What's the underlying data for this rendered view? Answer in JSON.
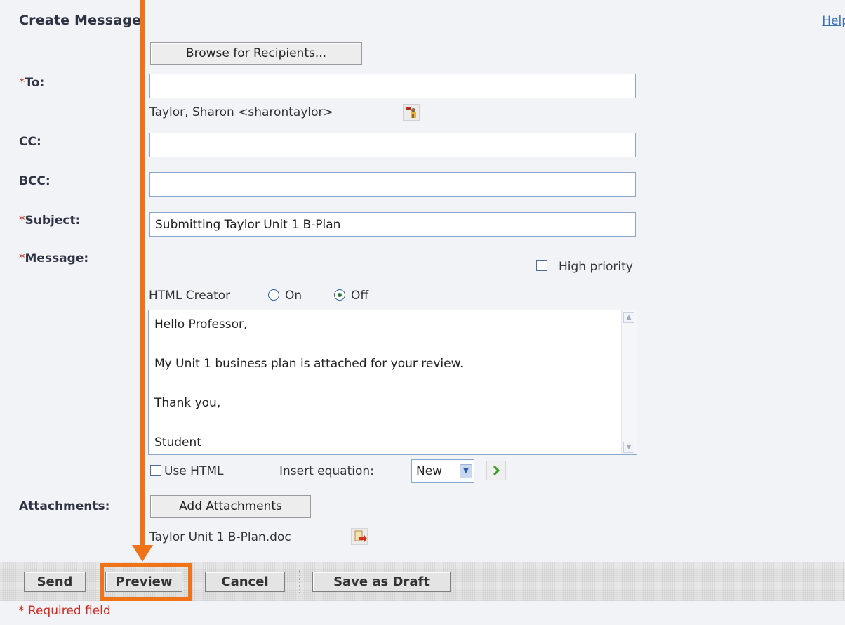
{
  "header": {
    "title": "Create Message",
    "help": "Help"
  },
  "recipients": {
    "browse_label": "Browse for Recipients..."
  },
  "fields": {
    "to": {
      "label": "To:",
      "value": "",
      "selected_recipient": "Taylor, Sharon <sharontaylor>"
    },
    "cc": {
      "label": "CC:",
      "value": ""
    },
    "bcc": {
      "label": "BCC:",
      "value": ""
    },
    "subject": {
      "label": "Subject:",
      "value": "Submitting Taylor Unit 1 B-Plan"
    },
    "message": {
      "label": "Message:"
    },
    "required_marker": "*"
  },
  "options": {
    "high_priority": "High priority",
    "html_creator": {
      "label": "HTML Creator",
      "on": "On",
      "off": "Off",
      "selected": "Off"
    }
  },
  "message_body": {
    "lines": [
      "Hello Professor,",
      "My Unit 1 business plan is attached for your review.",
      "Thank you,",
      "Student"
    ]
  },
  "editor_tools": {
    "use_html": "Use HTML",
    "insert_equation": "Insert equation:",
    "equation_option": "New"
  },
  "attachments": {
    "label": "Attachments:",
    "add_label": "Add Attachments",
    "file": "Taylor Unit 1 B-Plan.doc"
  },
  "actions": {
    "send": "Send",
    "preview": "Preview",
    "cancel": "Cancel",
    "save_draft": "Save as Draft"
  },
  "footer": {
    "required_note": "* Required field"
  },
  "colors": {
    "highlight": "#f07318",
    "required": "#d0281c",
    "link": "#3a6fb7"
  },
  "icons": [
    "remove-recipient-icon",
    "go-arrow-icon",
    "remove-attachment-icon",
    "dropdown-arrow-icon",
    "scroll-up-icon",
    "scroll-down-icon"
  ]
}
